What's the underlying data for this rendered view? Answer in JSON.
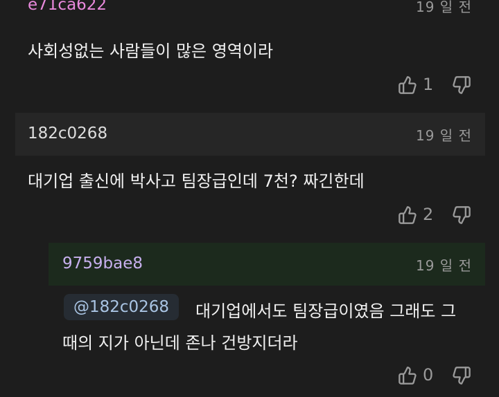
{
  "comments": [
    {
      "author": "e71ca622",
      "date": "19 일 전",
      "text": "사회성없는 사람들이 많은 영역이라",
      "likes": "1",
      "author_color": "#e889dc"
    },
    {
      "author": "182c0268",
      "date": "19 일 전",
      "text": "대기업 출신에 박사고 팀장급인데 7천? 짜긴한데",
      "likes": "2",
      "author_color": "#dedede"
    },
    {
      "author": "9759bae8",
      "date": "19 일 전",
      "mention": "@182c0268",
      "text_line1": "대기업에서도 팀장급이였음 그래도 그",
      "text_line2": "때의 지가 아닌데 존나 건방지더라",
      "likes": "0",
      "author_color": "#c7b0ee"
    }
  ],
  "icons": {
    "like": "thumbs-up-icon",
    "dislike": "thumbs-down-icon"
  }
}
